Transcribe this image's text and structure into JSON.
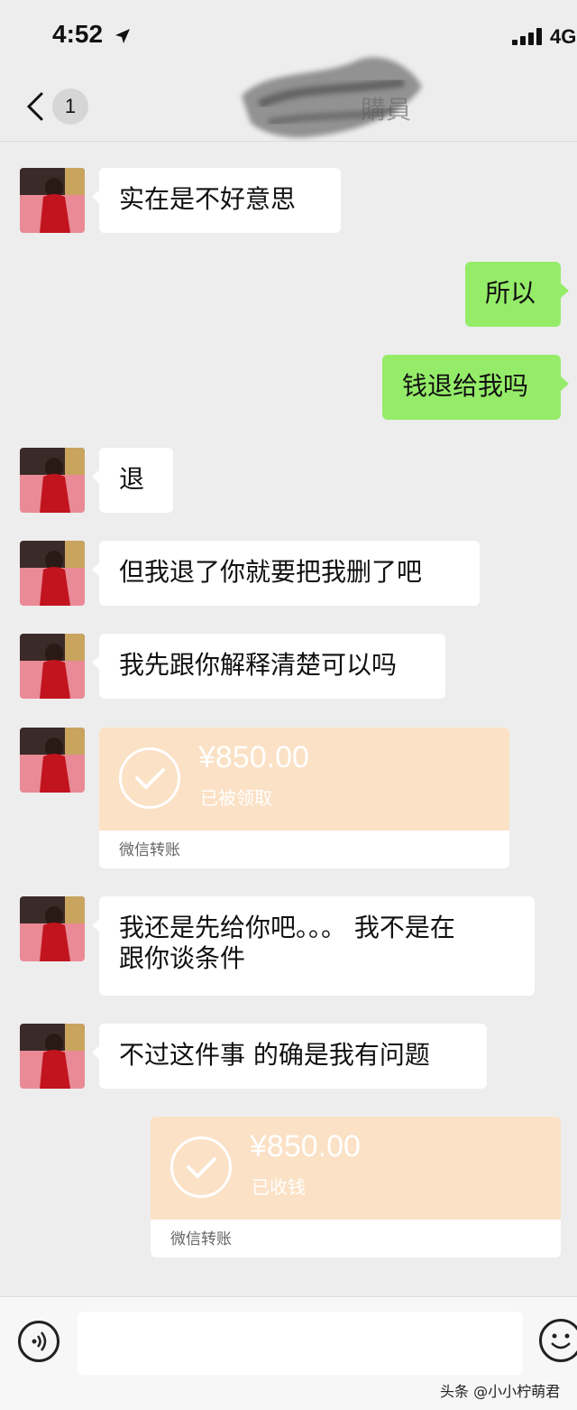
{
  "status_bar": {
    "time": "4:52",
    "network": "4G"
  },
  "header": {
    "unread_count": "1",
    "title_visible": "購員"
  },
  "messages": [
    {
      "side": "left",
      "text": "实在是不好意思"
    },
    {
      "side": "right",
      "text": "所以"
    },
    {
      "side": "right",
      "text": "钱退给我吗"
    },
    {
      "side": "left",
      "text": "退"
    },
    {
      "side": "left",
      "text": "但我退了你就要把我删了吧"
    },
    {
      "side": "left",
      "text": "我先跟你解释清楚可以吗"
    },
    {
      "side": "left",
      "type": "transfer",
      "amount": "¥850.00",
      "status": "已被领取",
      "label": "微信转账"
    },
    {
      "side": "left",
      "text_line1": "我还是先给你吧。。。 我不是在",
      "text_line2": "跟你谈条件"
    },
    {
      "side": "left",
      "text": "不过这件事 的确是我有问题"
    },
    {
      "side": "right",
      "type": "transfer",
      "amount": "¥850.00",
      "status": "已收钱",
      "label": "微信转账"
    }
  ],
  "input_bar": {
    "voice_icon": "voice-icon",
    "emoji_icon": "emoji-icon"
  },
  "watermark": "头条 @小小柠萌君",
  "colors": {
    "background": "#ededed",
    "bubble_self": "#95ec69",
    "transfer": "#fbe1c5"
  }
}
